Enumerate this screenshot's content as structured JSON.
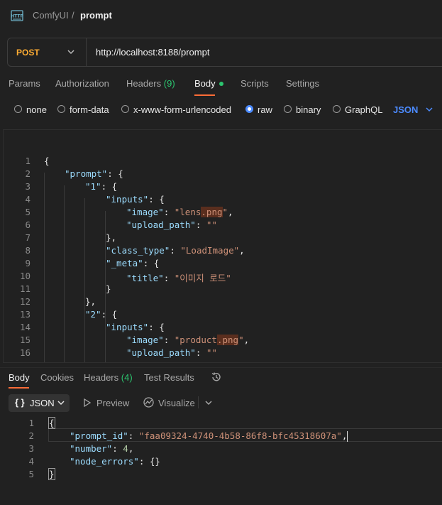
{
  "breadcrumb": {
    "parent": "ComfyUI",
    "separator": "/",
    "current": "prompt"
  },
  "request": {
    "method": "POST",
    "url": "http://localhost:8188/prompt",
    "tabs": {
      "params": "Params",
      "authorization": "Authorization",
      "headers": "Headers",
      "headers_count": "(9)",
      "body": "Body",
      "scripts": "Scripts",
      "settings": "Settings"
    },
    "body_types": [
      "none",
      "form-data",
      "x-www-form-urlencoded",
      "raw",
      "binary",
      "GraphQL"
    ],
    "selected_body_type": "raw",
    "language": "JSON"
  },
  "editor": {
    "line_numbers": [
      "1",
      "2",
      "3",
      "4",
      "5",
      "6",
      "7",
      "8",
      "9",
      "10",
      "11",
      "12",
      "13",
      "14",
      "15",
      "16"
    ],
    "lines": {
      "l1": "{",
      "l2k": "\"prompt\"",
      "l2r": ": {",
      "l3k": "\"1\"",
      "l3r": ": {",
      "l4k": "\"inputs\"",
      "l4r": ": {",
      "l5k": "\"image\"",
      "l5m": ": ",
      "l5s1": "\"lens",
      "l5s2": ".png",
      "l5s3": "\"",
      "l5e": ",",
      "l6k": "\"upload_path\"",
      "l6m": ": ",
      "l6s": "\"\"",
      "l7": "},",
      "l8k": "\"class_type\"",
      "l8m": ": ",
      "l8s": "\"LoadImage\"",
      "l8e": ",",
      "l9k": "\"_meta\"",
      "l9r": ": {",
      "l10k": "\"title\"",
      "l10m": ": ",
      "l10s": "\"이미지 로드\"",
      "l11": "}",
      "l12": "},",
      "l13k": "\"2\"",
      "l13r": ": {",
      "l14k": "\"inputs\"",
      "l14r": ": {",
      "l15k": "\"image\"",
      "l15m": ": ",
      "l15s1": "\"product",
      "l15s2": ".png",
      "l15s3": "\"",
      "l15e": ",",
      "l16k": "\"upload_path\"",
      "l16m": ": ",
      "l16s": "\"\""
    }
  },
  "response": {
    "tabs": {
      "body": "Body",
      "cookies": "Cookies",
      "headers": "Headers",
      "headers_count": "(4)",
      "test_results": "Test Results"
    },
    "format": "JSON",
    "format_braces": "{ }",
    "preview": "Preview",
    "visualize": "Visualize",
    "line_numbers": [
      "1",
      "2",
      "3",
      "4",
      "5"
    ],
    "lines": {
      "r1": "{",
      "r2k": "\"prompt_id\"",
      "r2m": ": ",
      "r2s": "\"faa09324-4740-4b58-86f8-bfc45318607a\"",
      "r2e": ",",
      "r3k": "\"number\"",
      "r3m": ": ",
      "r3n": "4",
      "r3e": ",",
      "r4k": "\"node_errors\"",
      "r4m": ": {}",
      "r5": "}"
    }
  },
  "colors": {
    "background": "#212121",
    "method": "#ffad33",
    "accent_blue": "#4c8bff",
    "active_tab": "#ff6c37",
    "count_green": "#2cc56f",
    "json_key": "#9cdcfe",
    "json_string": "#ce9178",
    "json_number": "#b5cea8"
  },
  "icons": [
    "http-icon",
    "chevron-down-icon",
    "history-icon",
    "preview-icon",
    "visualize-icon"
  ]
}
